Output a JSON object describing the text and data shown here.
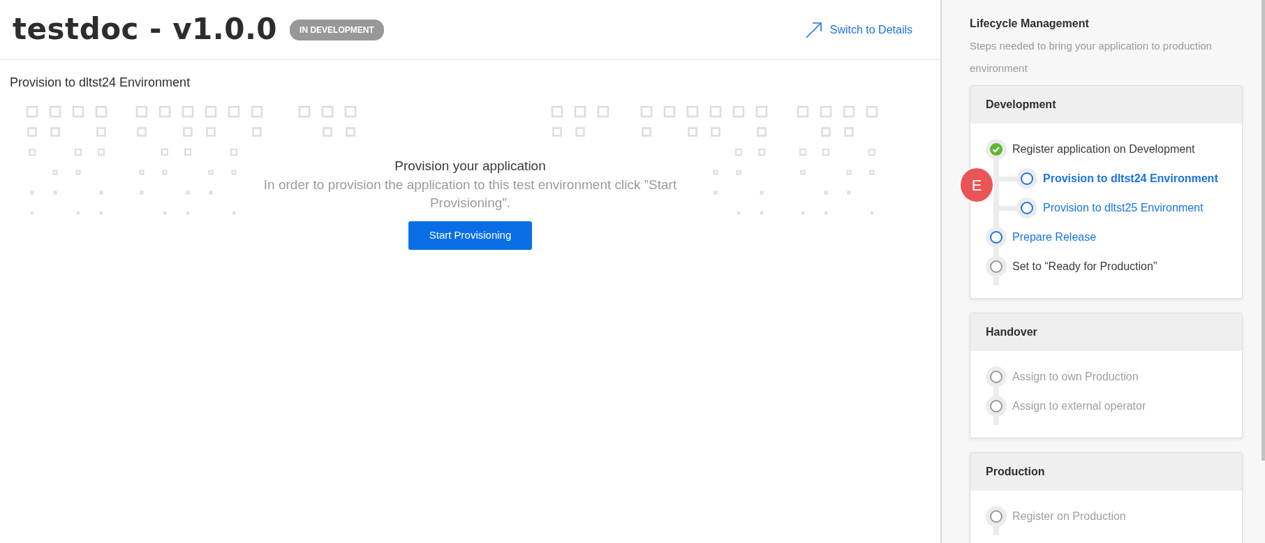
{
  "header": {
    "title": "testdoc - v1.0.0",
    "status_badge": "IN DEVELOPMENT",
    "switch_link": "Switch to Details"
  },
  "section_title": "Provision to dltst24 Environment",
  "empty_state": {
    "heading": "Provision your application",
    "message": "In order to provision the application to this test environment click ”Start Provisioning”.",
    "button": "Start Provisioning"
  },
  "sidebar": {
    "title": "Lifecycle Management",
    "subtitle": "Steps needed to bring your application to production environment",
    "stages": [
      {
        "title": "Development",
        "steps": [
          {
            "label": "Register application on Development",
            "kind": "done",
            "selected": false,
            "nested": false
          },
          {
            "label": "Provision to dltst24 Environment",
            "kind": "available",
            "selected": true,
            "nested": true
          },
          {
            "label": "Provision to dltst25 Environment",
            "kind": "available",
            "selected": false,
            "nested": true
          },
          {
            "label": "Prepare Release",
            "kind": "available",
            "selected": false,
            "nested": false
          },
          {
            "label": "Set to “Ready for Production”",
            "kind": "pending",
            "selected": false,
            "nested": false
          }
        ]
      },
      {
        "title": "Handover",
        "steps": [
          {
            "label": "Assign to own Production",
            "kind": "locked",
            "selected": false,
            "nested": false
          },
          {
            "label": "Assign to external operator",
            "kind": "locked",
            "selected": false,
            "nested": false
          }
        ]
      },
      {
        "title": "Production",
        "steps": [
          {
            "label": "Register on Production",
            "kind": "locked",
            "selected": false,
            "nested": false
          }
        ]
      }
    ]
  },
  "marker": {
    "label": "E"
  }
}
